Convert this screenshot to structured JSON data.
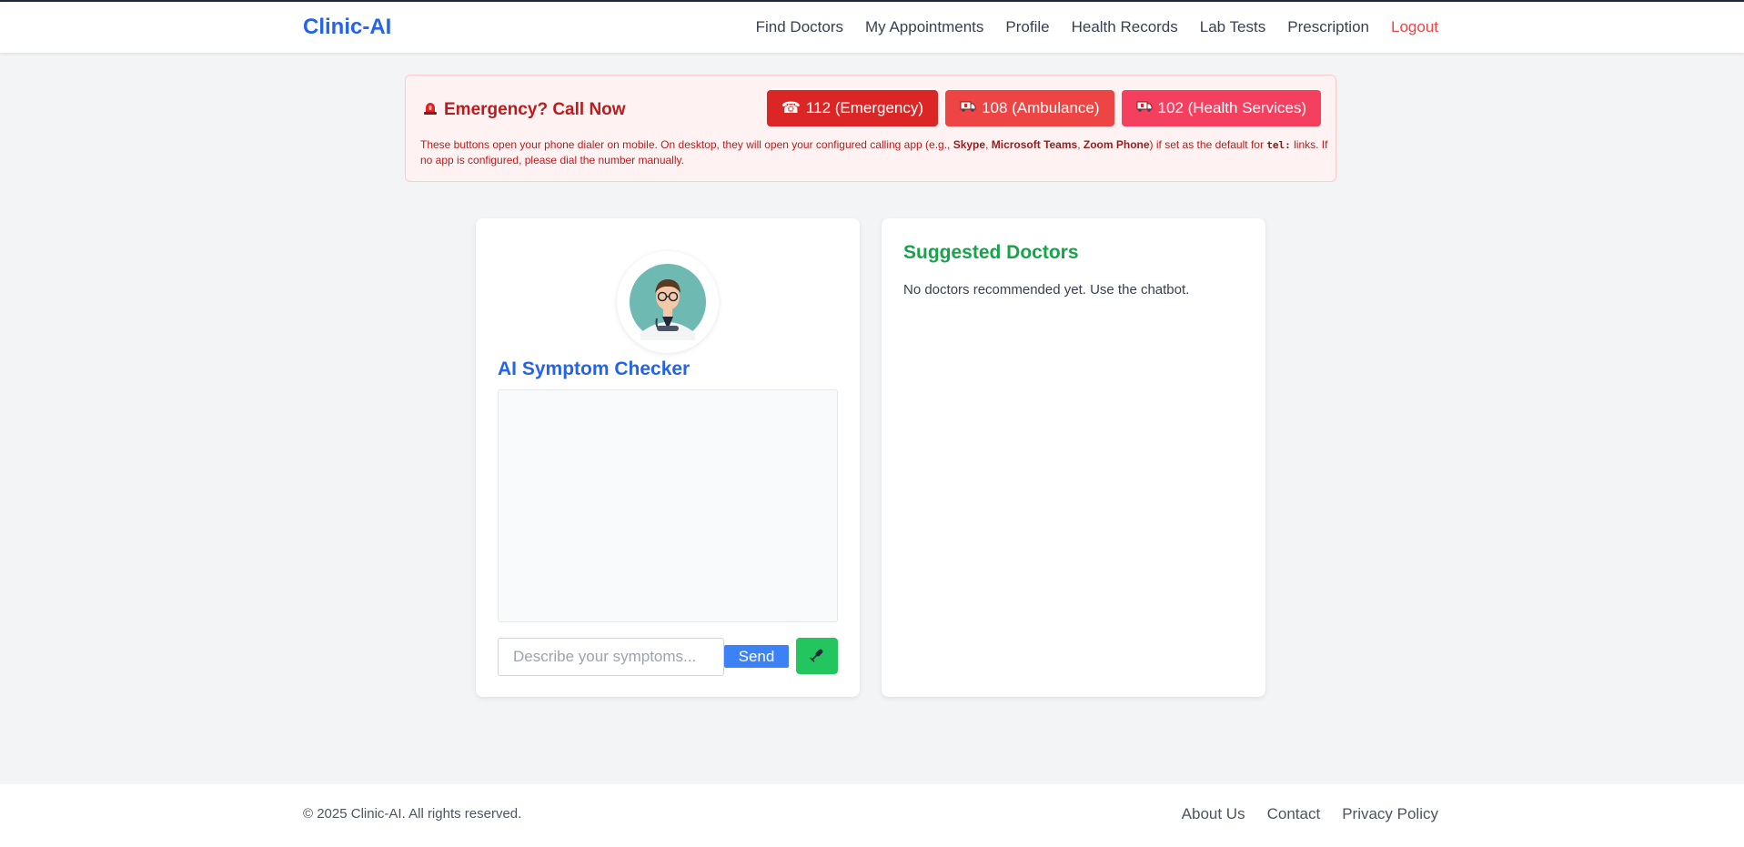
{
  "nav": {
    "brand": "Clinic-AI",
    "links": [
      "Find Doctors",
      "My Appointments",
      "Profile",
      "Health Records",
      "Lab Tests",
      "Prescription"
    ],
    "logout": "Logout"
  },
  "emergency": {
    "icon": "siren-icon",
    "title": "Emergency? Call Now",
    "buttons": [
      {
        "icon": "phone-icon",
        "label": "112 (Emergency)",
        "color": "#dc2626"
      },
      {
        "icon": "ambulance-icon",
        "label": "108 (Ambulance)",
        "color": "#ef4444"
      },
      {
        "icon": "ambulance-icon",
        "label": "102 (Health Services)",
        "color": "#f43f5e"
      }
    ],
    "note": {
      "part1": "These buttons open your phone dialer on mobile. On desktop, they will open your configured calling app (e.g., ",
      "app1": "Skype",
      "sep1": ", ",
      "app2": "Microsoft Teams",
      "sep2": ", ",
      "app3": "Zoom Phone",
      "part2": ") if set as the default for ",
      "code": "tel:",
      "part3": " links. If no app is configured, please dial the number manually."
    }
  },
  "checker": {
    "avatar_icon": "doctor-avatar-icon",
    "title": "AI Symptom Checker",
    "input_placeholder": "Describe your symptoms...",
    "send_label": "Send",
    "mic_icon": "microphone-icon"
  },
  "suggested": {
    "title": "Suggested Doctors",
    "empty_text": "No doctors recommended yet. Use the chatbot."
  },
  "footer": {
    "copyright": "© 2025 Clinic-AI. All rights reserved.",
    "links": [
      "About Us",
      "Contact",
      "Privacy Policy"
    ]
  },
  "colors": {
    "brand": "#2563eb",
    "logout": "#ef4444",
    "emergency_text": "#b91c1c",
    "send": "#3b82f6",
    "mic": "#22c55e",
    "suggested_title": "#16a34a"
  }
}
